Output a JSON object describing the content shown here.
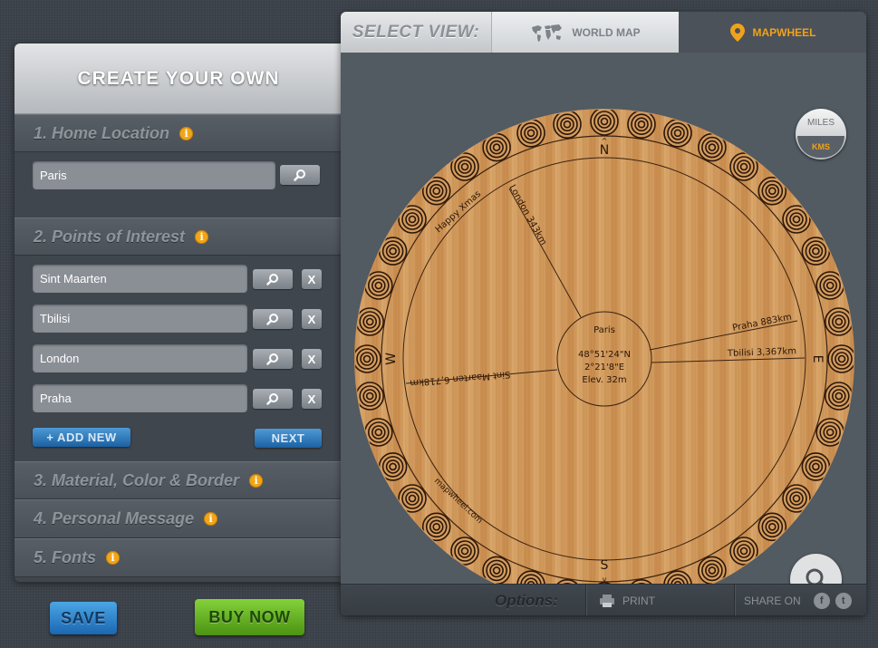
{
  "left_panel": {
    "title": "CREATE YOUR OWN",
    "sections": {
      "home": {
        "label": "1. Home Location",
        "info": "i"
      },
      "poi": {
        "label": "2. Points of Interest",
        "info": "i"
      },
      "material": {
        "label": "3. Material, Color & Border",
        "info": "i"
      },
      "message": {
        "label": "4. Personal Message",
        "info": "i"
      },
      "fonts": {
        "label": "5. Fonts",
        "info": "i"
      }
    },
    "home_location": "Paris",
    "points": [
      {
        "name": "Sint Maarten",
        "remove": "X"
      },
      {
        "name": "Tbilisi",
        "remove": "X"
      },
      {
        "name": "London",
        "remove": "X"
      },
      {
        "name": "Praha",
        "remove": "X"
      }
    ],
    "add_new_label": "+ ADD NEW",
    "next_label": "NEXT"
  },
  "actions": {
    "save": "SAVE",
    "buy_now": "BUY NOW"
  },
  "view": {
    "select_label": "SELECT VIEW:",
    "world_map": "WORLD MAP",
    "mapwheel": "MAPWHEEL",
    "active_tab": "MAPWHEEL"
  },
  "units": {
    "miles": "MILES",
    "kms": "KMS",
    "selected": "KMS"
  },
  "wheel": {
    "center_city": "Paris",
    "lat": "48°51'24\"N",
    "lon": "2°21'8\"E",
    "elev": "Elev. 32m",
    "compass": {
      "n": "N",
      "s": "S",
      "e": "E",
      "w": "W"
    },
    "labels": {
      "london": "London 343km",
      "praha": "Praha 883km",
      "tbilisi": "Tbilisi 3,367km",
      "sint_maarten": "Sint Maarten 6,718km",
      "message": "Happy Xmas",
      "brand": "mapwheel.com"
    }
  },
  "footer": {
    "options": "Options:",
    "print": "PRINT",
    "share_on": "SHARE ON",
    "facebook": "f",
    "twitter": "t"
  },
  "colors": {
    "accent": "#f0a21a",
    "blue": "#1c61a3",
    "green": "#4c9313",
    "wood": "#d19a5b"
  }
}
